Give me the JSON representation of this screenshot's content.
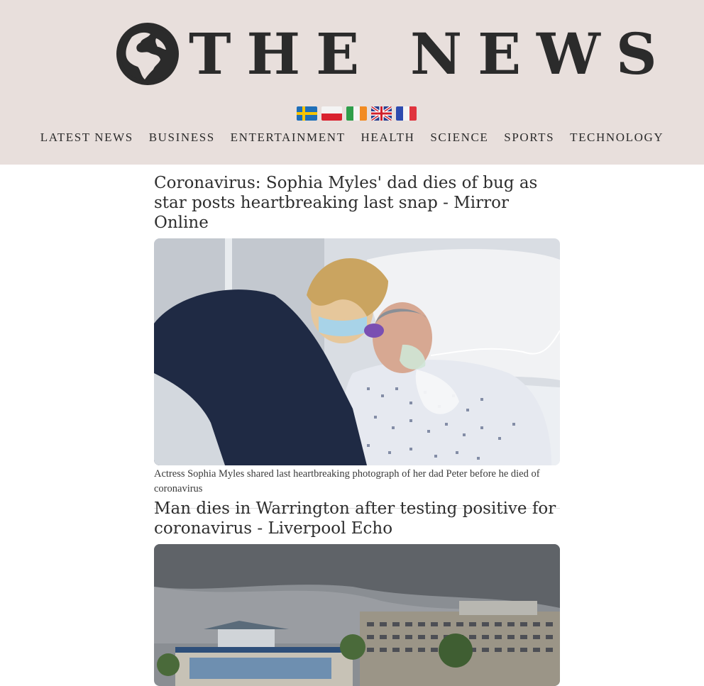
{
  "site": {
    "title": "THE NEWS"
  },
  "flags": [
    {
      "name": "sweden-flag"
    },
    {
      "name": "poland-flag"
    },
    {
      "name": "ireland-flag"
    },
    {
      "name": "uk-flag"
    },
    {
      "name": "france-flag"
    }
  ],
  "nav": {
    "items": [
      "LATEST NEWS",
      "BUSINESS",
      "ENTERTAINMENT",
      "HEALTH",
      "SCIENCE",
      "SPORTS",
      "TECHNOLOGY"
    ]
  },
  "articles": [
    {
      "headline": "Coronavirus: Sophia Myles' dad dies of bug as star posts heartbreaking last snap - Mirror Online",
      "caption": "Actress Sophia Myles shared last heartbreaking photograph of her dad Peter before he died of coronavirus"
    },
    {
      "headline": "Man dies in Warrington after testing positive for coronavirus - Liverpool Echo"
    }
  ],
  "colors": {
    "masthead_bg": "#e8dfdc",
    "text": "#2b2b2b"
  }
}
